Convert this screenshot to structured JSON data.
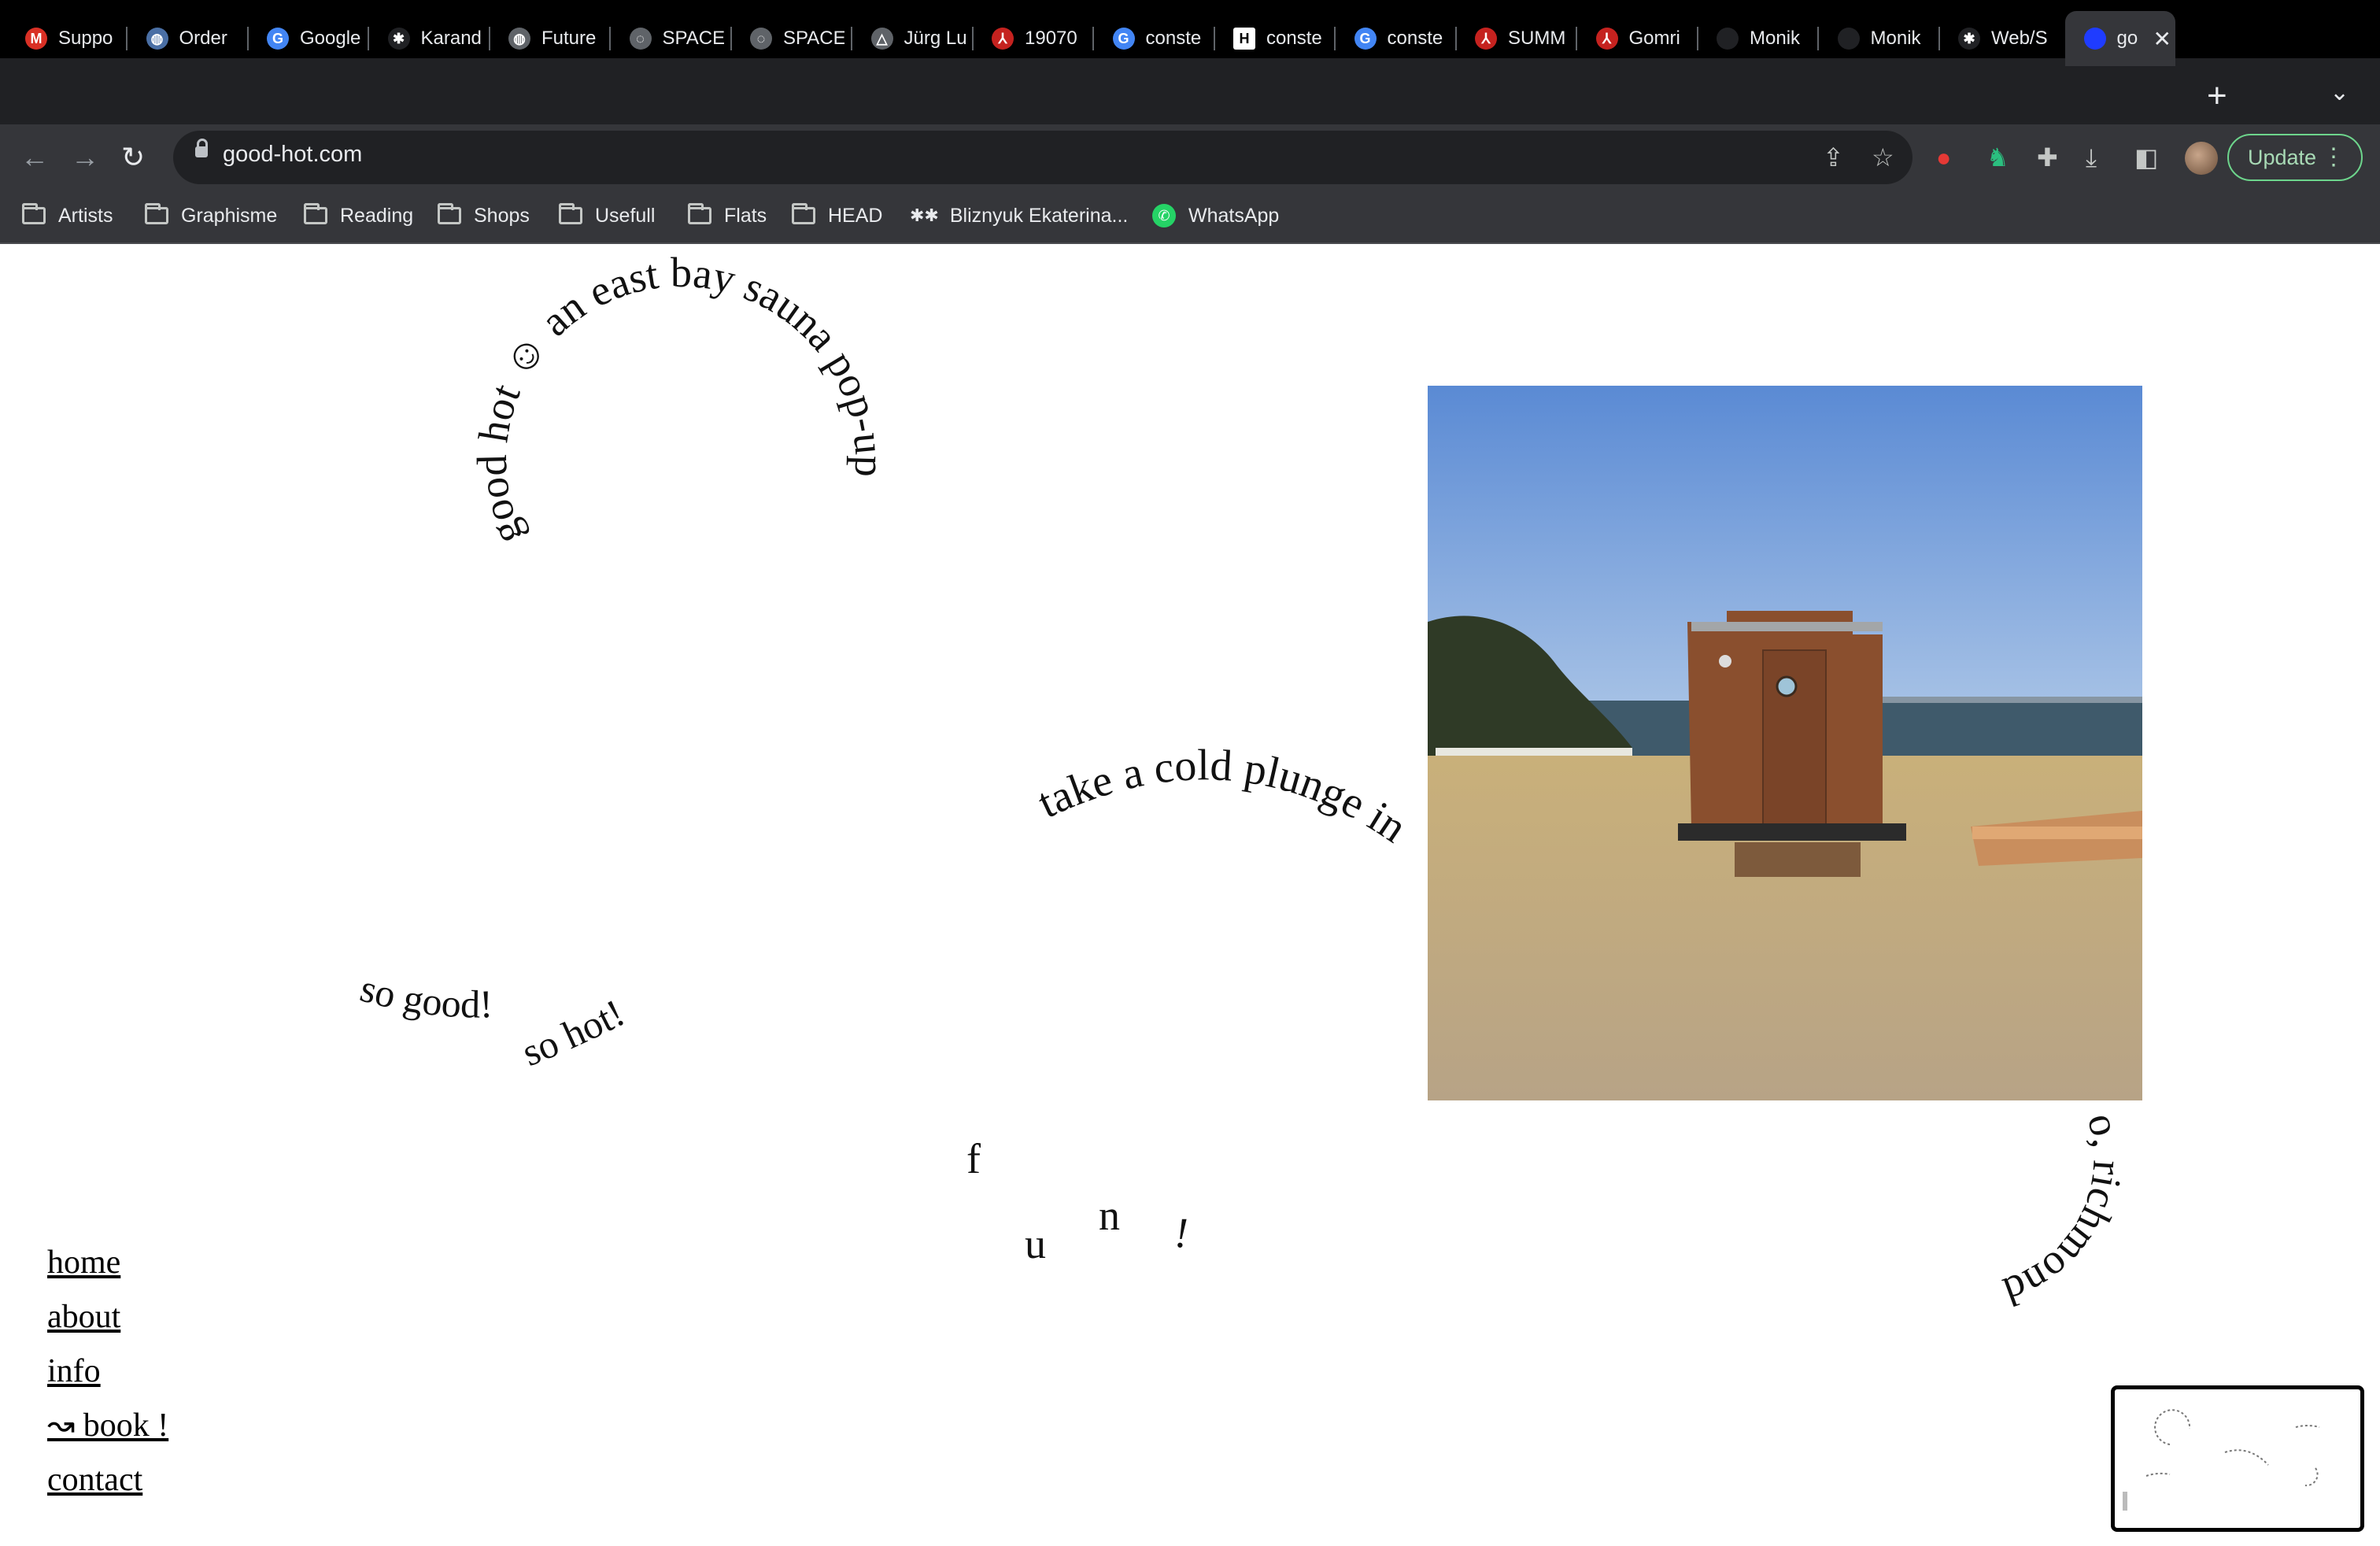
{
  "browser": {
    "tabs": [
      {
        "title": "Suppo",
        "icon": "gmail-icon",
        "color": "#d93025"
      },
      {
        "title": "Order",
        "icon": "globe-icon",
        "color": "#4a6fa5"
      },
      {
        "title": "Google",
        "icon": "google-icon",
        "color": "#4285f4"
      },
      {
        "title": "Karand",
        "icon": "stars-icon",
        "color": "#202124"
      },
      {
        "title": "Future",
        "icon": "globe-icon",
        "color": "#5f6368"
      },
      {
        "title": "SPACE",
        "icon": "spinner-icon",
        "color": "#5f6368"
      },
      {
        "title": "SPACE",
        "icon": "spinner-icon",
        "color": "#5f6368"
      },
      {
        "title": "Jürg Lu",
        "icon": "triangle-icon",
        "color": "#5f6368"
      },
      {
        "title": "19070",
        "icon": "pdf-icon",
        "color": "#c5221f"
      },
      {
        "title": "conste",
        "icon": "google-icon",
        "color": "#4285f4"
      },
      {
        "title": "conste",
        "icon": "hl-icon",
        "color": "#ffffff"
      },
      {
        "title": "conste",
        "icon": "google-icon",
        "color": "#4285f4"
      },
      {
        "title": "SUMM",
        "icon": "pdf-icon",
        "color": "#c5221f"
      },
      {
        "title": "Gomri",
        "icon": "pdf-icon",
        "color": "#c5221f"
      },
      {
        "title": "Monik",
        "icon": "dot-icon",
        "color": "#202124"
      },
      {
        "title": "Monik",
        "icon": "dot-icon",
        "color": "#202124"
      },
      {
        "title": "Web/S",
        "icon": "stars-icon",
        "color": "#202124"
      },
      {
        "title": "go",
        "icon": "blue-circle-icon",
        "color": "#1f3cff",
        "active": true
      }
    ],
    "url": "good-hot.com",
    "update_label": "Update",
    "bookmarks": [
      {
        "label": "Artists",
        "icon": "folder-icon"
      },
      {
        "label": "Graphisme",
        "icon": "folder-icon"
      },
      {
        "label": "Reading",
        "icon": "folder-icon"
      },
      {
        "label": "Shops",
        "icon": "folder-icon"
      },
      {
        "label": "Usefull",
        "icon": "folder-icon"
      },
      {
        "label": "Flats",
        "icon": "folder-icon"
      },
      {
        "label": "HEAD",
        "icon": "folder-icon"
      },
      {
        "label": "Bliznyuk Ekaterina...",
        "icon": "stars-icon"
      },
      {
        "label": "WhatsApp",
        "icon": "whatsapp-icon"
      }
    ]
  },
  "site": {
    "circle_text": "good hot ☺ an east bay sauna pop-up",
    "plunge_text": "take a cold plunge in",
    "richmond_text": "o, richmond",
    "so_good": "so good!",
    "so_hot": "so hot!",
    "fun_letters": [
      "f",
      "u",
      "n",
      "!"
    ],
    "nav": [
      "home",
      "about",
      "info",
      "↝ book !",
      "contact"
    ]
  }
}
